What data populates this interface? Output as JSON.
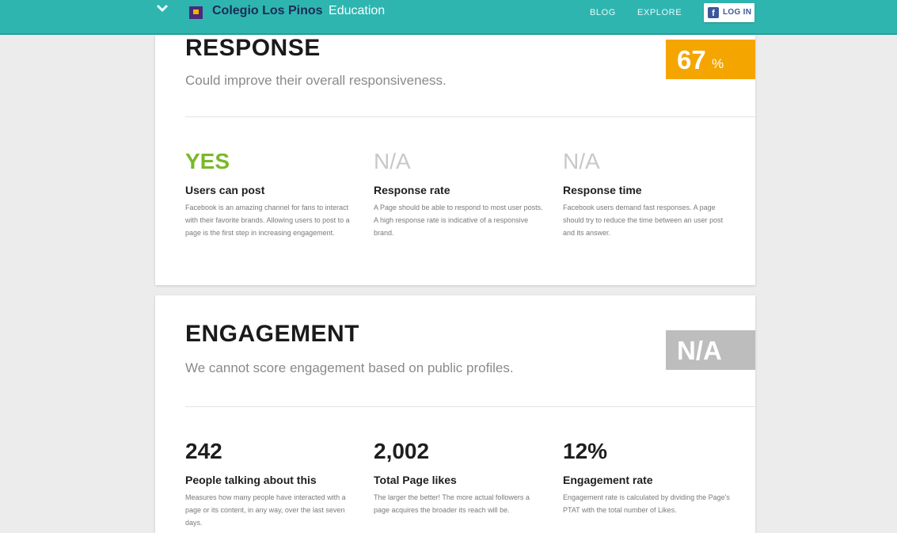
{
  "header": {
    "brand_name": "Colegio Los Pinos",
    "brand_category": "Education",
    "nav": [
      "BLOG",
      "EXPLORE"
    ],
    "login_label": "LOG IN"
  },
  "response": {
    "title": "RESPONSE",
    "subtitle": "Could improve their overall responsiveness.",
    "score_value": "67",
    "score_unit": "%",
    "score_color": "#f5a500",
    "metrics": [
      {
        "value": "YES",
        "value_color": "#7ab829",
        "name": "Users can post",
        "desc": "Facebook is an amazing channel for fans to interact with their favorite brands. Allowing users to post to a page is the first step in increasing engagement."
      },
      {
        "value": "N/A",
        "value_color": "#c8c8c8",
        "name": "Response rate",
        "desc": "A Page should be able to respond to most user posts. A high response rate is indicative of a responsive brand."
      },
      {
        "value": "N/A",
        "value_color": "#c8c8c8",
        "name": "Response time",
        "desc": "Facebook users demand fast responses. A page should try to reduce the time between an user post and its answer."
      }
    ]
  },
  "engagement": {
    "title": "ENGAGEMENT",
    "subtitle": "We cannot score engagement based on public profiles.",
    "score_value": "N/A",
    "score_color": "#bdbdbd",
    "metrics": [
      {
        "value": "242",
        "name": "People talking about this",
        "desc": "Measures how many people have interacted with a page or its content, in any way, over the last seven days."
      },
      {
        "value": "2,002",
        "name": "Total Page likes",
        "desc": "The larger the better! The more actual followers a page acquires the broader its reach will be."
      },
      {
        "value": "12%",
        "name": "Engagement rate",
        "desc": "Engagement rate is calculated by dividing the Page's PTAT with the total number of Likes."
      }
    ]
  }
}
